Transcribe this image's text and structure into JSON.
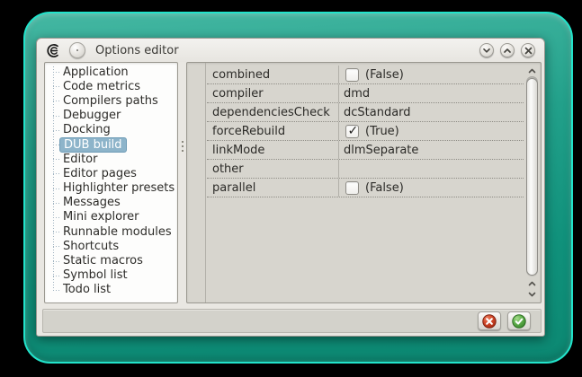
{
  "window": {
    "title": "Options editor",
    "app_icon": "coedit-logo-icon",
    "controls": [
      {
        "name": "rolldown-button",
        "icon": "chevron-down-icon"
      },
      {
        "name": "rollup-button",
        "icon": "chevron-up-icon"
      },
      {
        "name": "close-button",
        "icon": "close-icon"
      }
    ]
  },
  "sidebar": {
    "items": [
      "Application",
      "Code metrics",
      "Compilers paths",
      "Debugger",
      "Docking",
      "DUB build",
      "Editor",
      "Editor pages",
      "Highlighter presets",
      "Messages",
      "Mini explorer",
      "Runnable modules",
      "Shortcuts",
      "Static macros",
      "Symbol list",
      "Todo list"
    ],
    "selected_index": 5,
    "selected_item": "DUB build"
  },
  "properties": {
    "rows": [
      {
        "name": "combined",
        "type": "bool",
        "checked": false,
        "value": "(False)"
      },
      {
        "name": "compiler",
        "type": "text",
        "value": "dmd"
      },
      {
        "name": "dependenciesCheck",
        "type": "text",
        "value": "dcStandard"
      },
      {
        "name": "forceRebuild",
        "type": "bool",
        "checked": true,
        "value": "(True)"
      },
      {
        "name": "linkMode",
        "type": "text",
        "value": "dlmSeparate"
      },
      {
        "name": "other",
        "type": "text",
        "value": ""
      },
      {
        "name": "parallel",
        "type": "bool",
        "checked": false,
        "value": "(False)"
      }
    ]
  },
  "footer": {
    "buttons": [
      {
        "name": "cancel-button",
        "icon": "red-cross-icon"
      },
      {
        "name": "accept-button",
        "icon": "green-check-icon"
      }
    ]
  },
  "glyphs": {
    "check": "✓"
  },
  "colors": {
    "frame_teal": "#10917b",
    "frame_glow": "#22e4cb",
    "window_bg": "#e9e7e2",
    "grid_bg": "#d7d5ce",
    "list_bg": "#fdfdfc",
    "selection_bg": "#8db4ca",
    "selection_border": "#6f9cb6",
    "selection_text": "#ffffff",
    "text": "#2b2a27",
    "cancel_red": "#c23a20",
    "accept_green": "#54a847"
  }
}
